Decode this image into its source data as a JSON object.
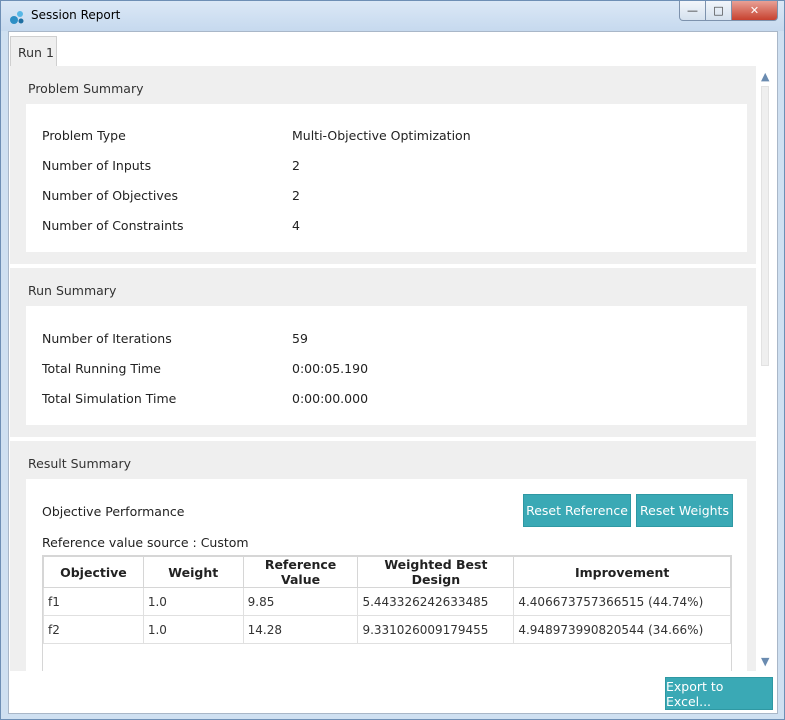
{
  "window": {
    "title": "Session Report",
    "buttons": {
      "minimize": "—",
      "maximize": "□",
      "close": "✕"
    }
  },
  "tabs": [
    {
      "label": "Run 1"
    }
  ],
  "problem_summary": {
    "title": "Problem Summary",
    "rows": [
      {
        "key": "Problem Type",
        "value": "Multi-Objective Optimization"
      },
      {
        "key": "Number of Inputs",
        "value": "2"
      },
      {
        "key": "Number of Objectives",
        "value": "2"
      },
      {
        "key": "Number of Constraints",
        "value": "4"
      }
    ]
  },
  "run_summary": {
    "title": "Run Summary",
    "rows": [
      {
        "key": "Number of Iterations",
        "value": "59"
      },
      {
        "key": "Total Running Time",
        "value": "0:00:05.190"
      },
      {
        "key": "Total Simulation Time",
        "value": "0:00:00.000"
      }
    ]
  },
  "result_summary": {
    "title": "Result Summary",
    "objective_performance": "Objective Performance",
    "reference_source": "Reference value source : Custom",
    "reset_reference": "Reset Reference",
    "reset_weights": "Reset Weights",
    "table": {
      "headers": [
        "Objective",
        "Weight",
        "Reference Value",
        "Weighted Best Design",
        "Improvement"
      ],
      "rows": [
        [
          "f1",
          "1.0",
          "9.85",
          "5.443326242633485",
          "4.406673757366515 (44.74%)"
        ],
        [
          "f2",
          "1.0",
          "14.28",
          "9.331026009179455",
          "4.948973990820544 (34.66%)"
        ]
      ]
    }
  },
  "export_button": "Export to Excel...",
  "colors": {
    "accent": "#3aa9b5",
    "panel": "#efefef",
    "frame": "#cfe0f1"
  }
}
